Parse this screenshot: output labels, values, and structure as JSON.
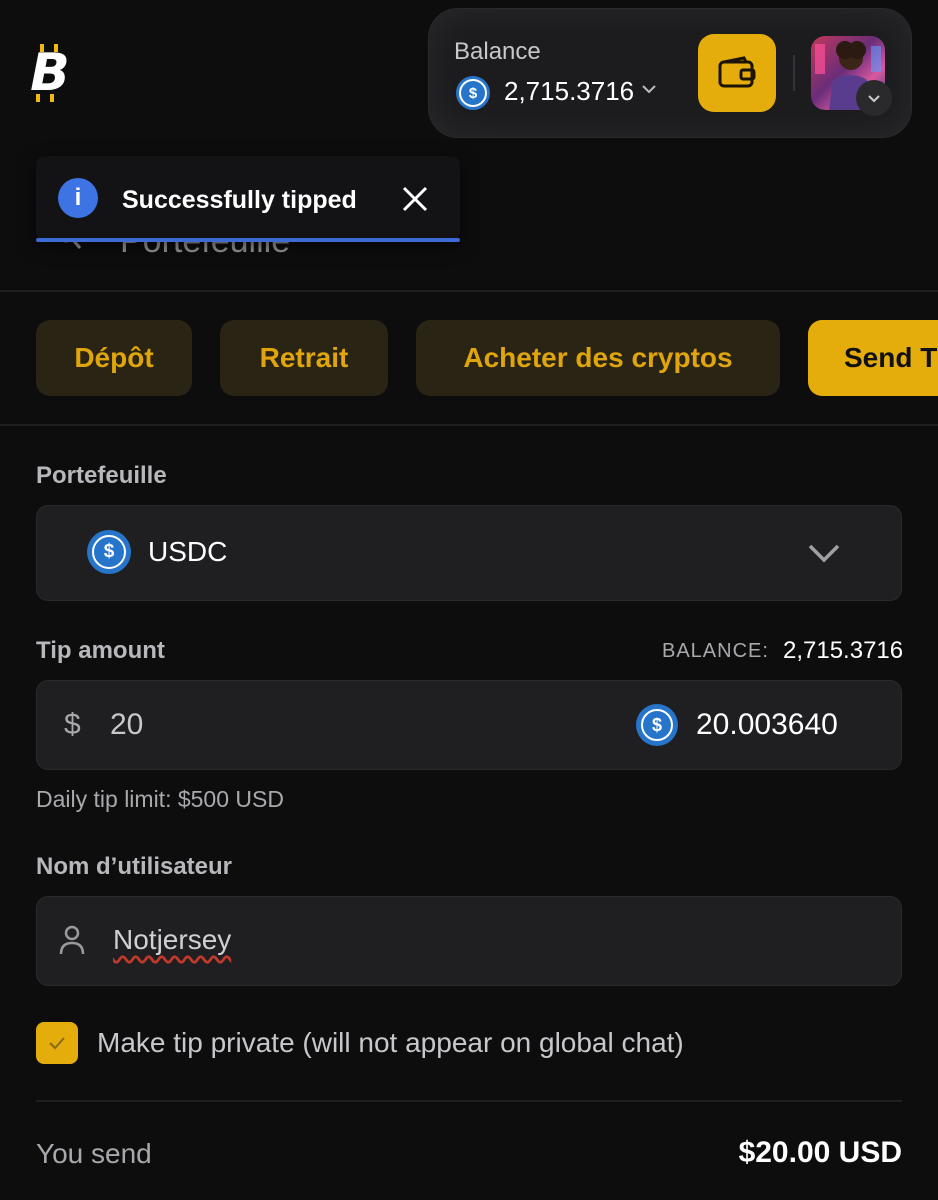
{
  "header": {
    "balance_label": "Balance",
    "balance_amount": "2,715.3716",
    "coin_icon": "usdc-icon",
    "wallet_icon": "wallet-icon",
    "avatar_icon": "user-avatar"
  },
  "toast": {
    "message": "Successfully tipped",
    "behind_text": "Portefeuille"
  },
  "tabs": [
    {
      "label": "Dépôt"
    },
    {
      "label": "Retrait"
    },
    {
      "label": "Acheter des cryptos"
    },
    {
      "label": "Send T"
    }
  ],
  "form": {
    "wallet_label": "Portefeuille",
    "wallet_value": "USDC",
    "tip_label": "Tip amount",
    "balance_caption": "BALANCE:",
    "balance_value": "2,715.3716",
    "currency_symbol": "$",
    "tip_usd": "20",
    "tip_crypto": "20.003640",
    "daily_limit": "Daily tip limit: $500 USD",
    "username_label": "Nom d’utilisateur",
    "username_value": "Notjersey",
    "private_label": "Make tip private (will not appear on global chat)",
    "private_checked": true,
    "you_send_label": "You send",
    "you_send_value": "$20.00 USD"
  },
  "colors": {
    "accent": "#e5ad0b",
    "background": "#0d0d0e",
    "info": "#3d73e3",
    "usdc": "#2775ca"
  }
}
